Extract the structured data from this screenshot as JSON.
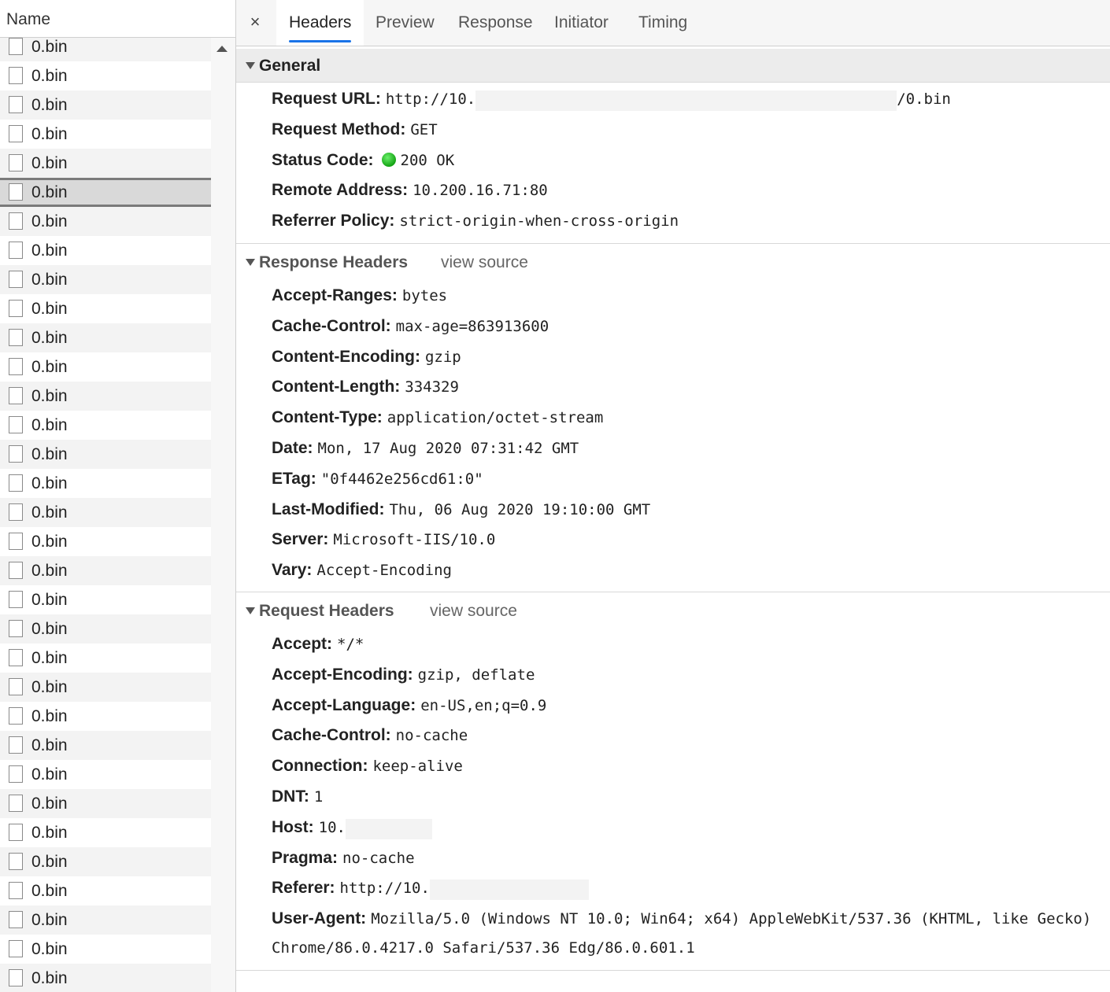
{
  "list": {
    "header": "Name",
    "items": [
      "0.bin",
      "0.bin",
      "0.bin",
      "0.bin",
      "0.bin",
      "0.bin",
      "0.bin",
      "0.bin",
      "0.bin",
      "0.bin",
      "0.bin",
      "0.bin",
      "0.bin",
      "0.bin",
      "0.bin",
      "0.bin",
      "0.bin",
      "0.bin",
      "0.bin",
      "0.bin",
      "0.bin",
      "0.bin",
      "0.bin",
      "0.bin",
      "0.bin",
      "0.bin",
      "0.bin",
      "0.bin",
      "0.bin",
      "0.bin",
      "0.bin",
      "0.bin",
      "0.bin",
      "0.bin"
    ],
    "selected_index": 5
  },
  "tabs": {
    "close": "×",
    "items": [
      "Headers",
      "Preview",
      "Response",
      "Initiator",
      "Timing"
    ],
    "active": "Headers"
  },
  "general": {
    "title": "General",
    "request_url_label": "Request URL:",
    "request_url_prefix": "http://10.",
    "request_url_suffix": "/0.bin",
    "request_method_label": "Request Method:",
    "request_method": "GET",
    "status_code_label": "Status Code:",
    "status_code": "200 OK",
    "status_color": "#22b422",
    "remote_address_label": "Remote Address:",
    "remote_address": "10.200.16.71:80",
    "referrer_policy_label": "Referrer Policy:",
    "referrer_policy": "strict-origin-when-cross-origin"
  },
  "response_headers": {
    "title": "Response Headers",
    "view_source": "view source",
    "rows": [
      {
        "name": "Accept-Ranges:",
        "value": "bytes"
      },
      {
        "name": "Cache-Control:",
        "value": "max-age=863913600"
      },
      {
        "name": "Content-Encoding:",
        "value": "gzip"
      },
      {
        "name": "Content-Length:",
        "value": "334329"
      },
      {
        "name": "Content-Type:",
        "value": "application/octet-stream"
      },
      {
        "name": "Date:",
        "value": "Mon, 17 Aug 2020 07:31:42 GMT"
      },
      {
        "name": "ETag:",
        "value": "\"0f4462e256cd61:0\""
      },
      {
        "name": "Last-Modified:",
        "value": "Thu, 06 Aug 2020 19:10:00 GMT"
      },
      {
        "name": "Server:",
        "value": "Microsoft-IIS/10.0"
      },
      {
        "name": "Vary:",
        "value": "Accept-Encoding"
      }
    ]
  },
  "request_headers": {
    "title": "Request Headers",
    "view_source": "view source",
    "rows": [
      {
        "name": "Accept:",
        "value": "*/*"
      },
      {
        "name": "Accept-Encoding:",
        "value": "gzip, deflate"
      },
      {
        "name": "Accept-Language:",
        "value": "en-US,en;q=0.9"
      },
      {
        "name": "Cache-Control:",
        "value": "no-cache"
      },
      {
        "name": "Connection:",
        "value": "keep-alive"
      },
      {
        "name": "DNT:",
        "value": "1"
      },
      {
        "name": "Host:",
        "value": "10."
      },
      {
        "name": "Pragma:",
        "value": "no-cache"
      },
      {
        "name": "Referer:",
        "value": "http://10."
      },
      {
        "name": "User-Agent:",
        "value": "Mozilla/5.0 (Windows NT 10.0; Win64; x64) AppleWebKit/537.36 (KHTML, like Gecko)"
      }
    ],
    "user_agent_continuation": "Chrome/86.0.4217.0 Safari/537.36 Edg/86.0.601.1"
  }
}
